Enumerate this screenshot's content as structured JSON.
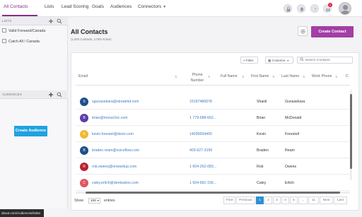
{
  "nav": {
    "tabs": [
      {
        "label": "All Contacts"
      },
      {
        "label": "Lists"
      },
      {
        "label": "Lead Scoring"
      },
      {
        "label": "Goals"
      },
      {
        "label": "Audiences"
      },
      {
        "label": "Connectors"
      }
    ],
    "notification_count": "1"
  },
  "sidebar": {
    "lists_header": "LISTS",
    "lists": [
      {
        "label": "Valid Forward/Canada"
      },
      {
        "label": "Catch All / Canada"
      }
    ],
    "audiences_header": "AUDIENCES",
    "create_audience_label": "Create Audience"
  },
  "main": {
    "title": "All Contacts",
    "subtitle": "(1,003 Contacts, 1,003 Active)",
    "create_contact_label": "Create Contact",
    "filter_label": "Filter",
    "columns_label": "Columns",
    "search_placeholder": "Search Contacts",
    "columns": [
      "Email",
      "Phone Number",
      "Full Name",
      "First Name",
      "Last Name",
      "Work Phone",
      "C"
    ],
    "rows": [
      {
        "initial": "S",
        "color": "#1e4f8c",
        "email": "sgunasekara@streatmd.com",
        "phone": "15197486878",
        "first": "Shanil",
        "last": "Gunasekara"
      },
      {
        "initial": "B",
        "color": "#5b3ca8",
        "email": "brian@mona1inc.com",
        "phone": "1 779-588-662...",
        "first": "Brian",
        "last": "McDonald"
      },
      {
        "initial": "K",
        "color": "#f4b733",
        "email": "kevin.forestel@doorr.com",
        "phone": "14035694400",
        "first": "Kevin",
        "last": "Forestell"
      },
      {
        "initial": "B",
        "color": "#1e4f8c",
        "email": "braden.ream@voiceflow.com",
        "phone": "403-627-3156",
        "first": "Braden",
        "last": "Ream"
      },
      {
        "initial": "R",
        "color": "#b8222e",
        "email": "rob.owens@onwardup.com",
        "phone": "1 604-262-083...",
        "first": "Rob",
        "last": "Owens"
      },
      {
        "initial": "C",
        "color": "#e05560",
        "email": "caley.erlich@dentsubos.com",
        "phone": "1 604-681-156...",
        "first": "Caley",
        "last": "Erlich"
      }
    ],
    "show_label": "Show",
    "page_size": "100",
    "entries_label": "entries",
    "pagination": [
      "First",
      "Previous",
      "1",
      "2",
      "3",
      "4",
      "5",
      "...",
      "11",
      "Next",
      "Last"
    ]
  },
  "status_url": "about.com/Audiences/index"
}
